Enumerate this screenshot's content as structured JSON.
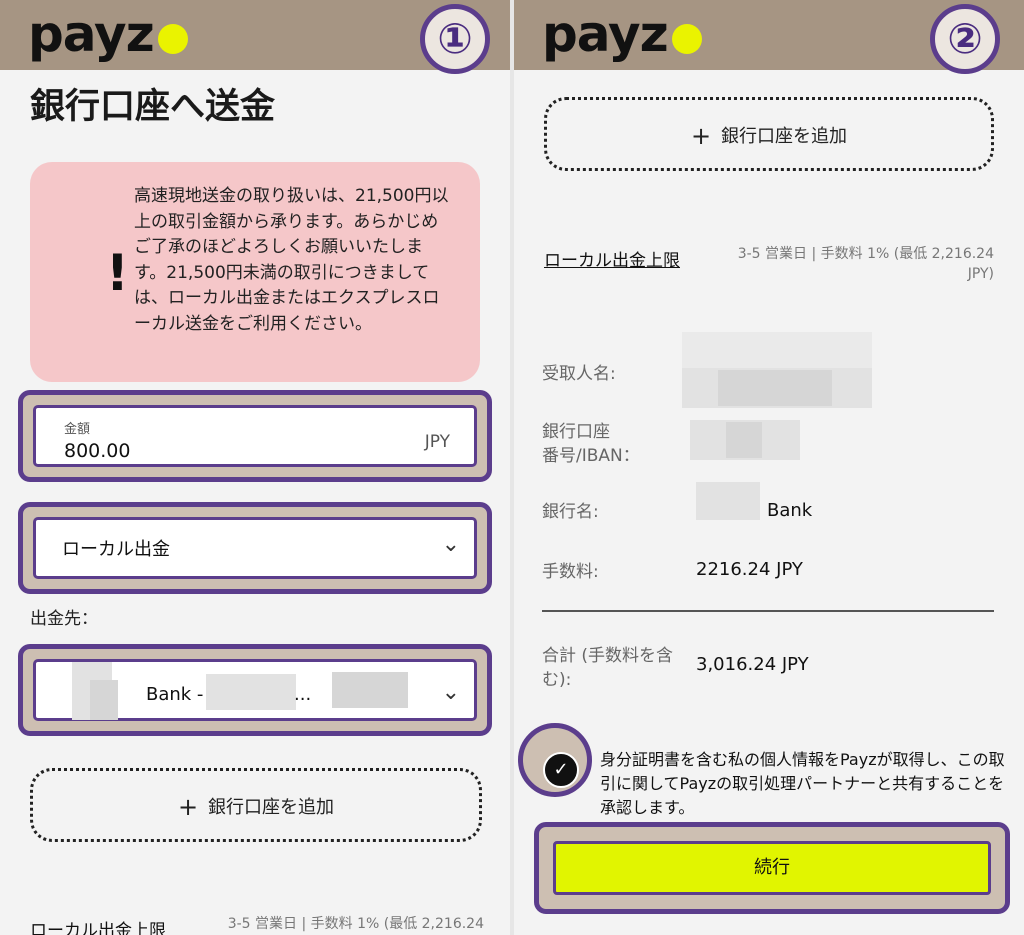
{
  "brand": {
    "logo": "payz",
    "accent": "#eaf300",
    "highlight": "#5b3d8c",
    "topbar": "#a69583"
  },
  "left": {
    "step": "①",
    "title": "銀行口座へ送金",
    "alert": {
      "icon": "!",
      "text": "高速現地送金の取り扱いは、21,500円以上の取引金額から承ります。あらかじめご了承のほどよろしくお願いいたします。21,500円未満の取引につきましては、ローカル出金またはエクスプレスローカル送金をご利用ください。"
    },
    "amount": {
      "label": "金額",
      "value": "800.00",
      "currency": "JPY"
    },
    "method": {
      "value": "ローカル出金"
    },
    "destination": {
      "label": "出金先：",
      "value": "Bank -",
      "ellipsis": "..."
    },
    "add_bank": {
      "plus": "+",
      "label": "銀行口座を追加"
    },
    "limit": {
      "link": "ローカル出金上限",
      "info": "3-5 営業日 | 手数料 1% (最低 2,216.24"
    }
  },
  "right": {
    "step": "②",
    "add_bank": {
      "plus": "+",
      "label": "銀行口座を追加"
    },
    "limit": {
      "link": "ローカル出金上限",
      "info_line1": "3-5 営業日 | 手数料 1% (最低 2,216.24",
      "info_line2": "JPY)"
    },
    "details": {
      "recipient_label": "受取人名:",
      "account_label_1": "銀行口座",
      "account_label_2": "番号/IBAN：",
      "bank_label": "銀行名:",
      "bank_value": "Bank",
      "fee_label": "手数料:",
      "fee_value": "2216.24  JPY",
      "total_label_1": "合計 (手数料を含",
      "total_label_2": "む):",
      "total_value": "3,016.24  JPY"
    },
    "consent": {
      "checked": true,
      "text": "身分証明書を含む私の個人情報をPayzが取得し、この取引に関してPayzの取引処理パートナーと共有することを承認します。"
    },
    "continue_label": "続行"
  }
}
